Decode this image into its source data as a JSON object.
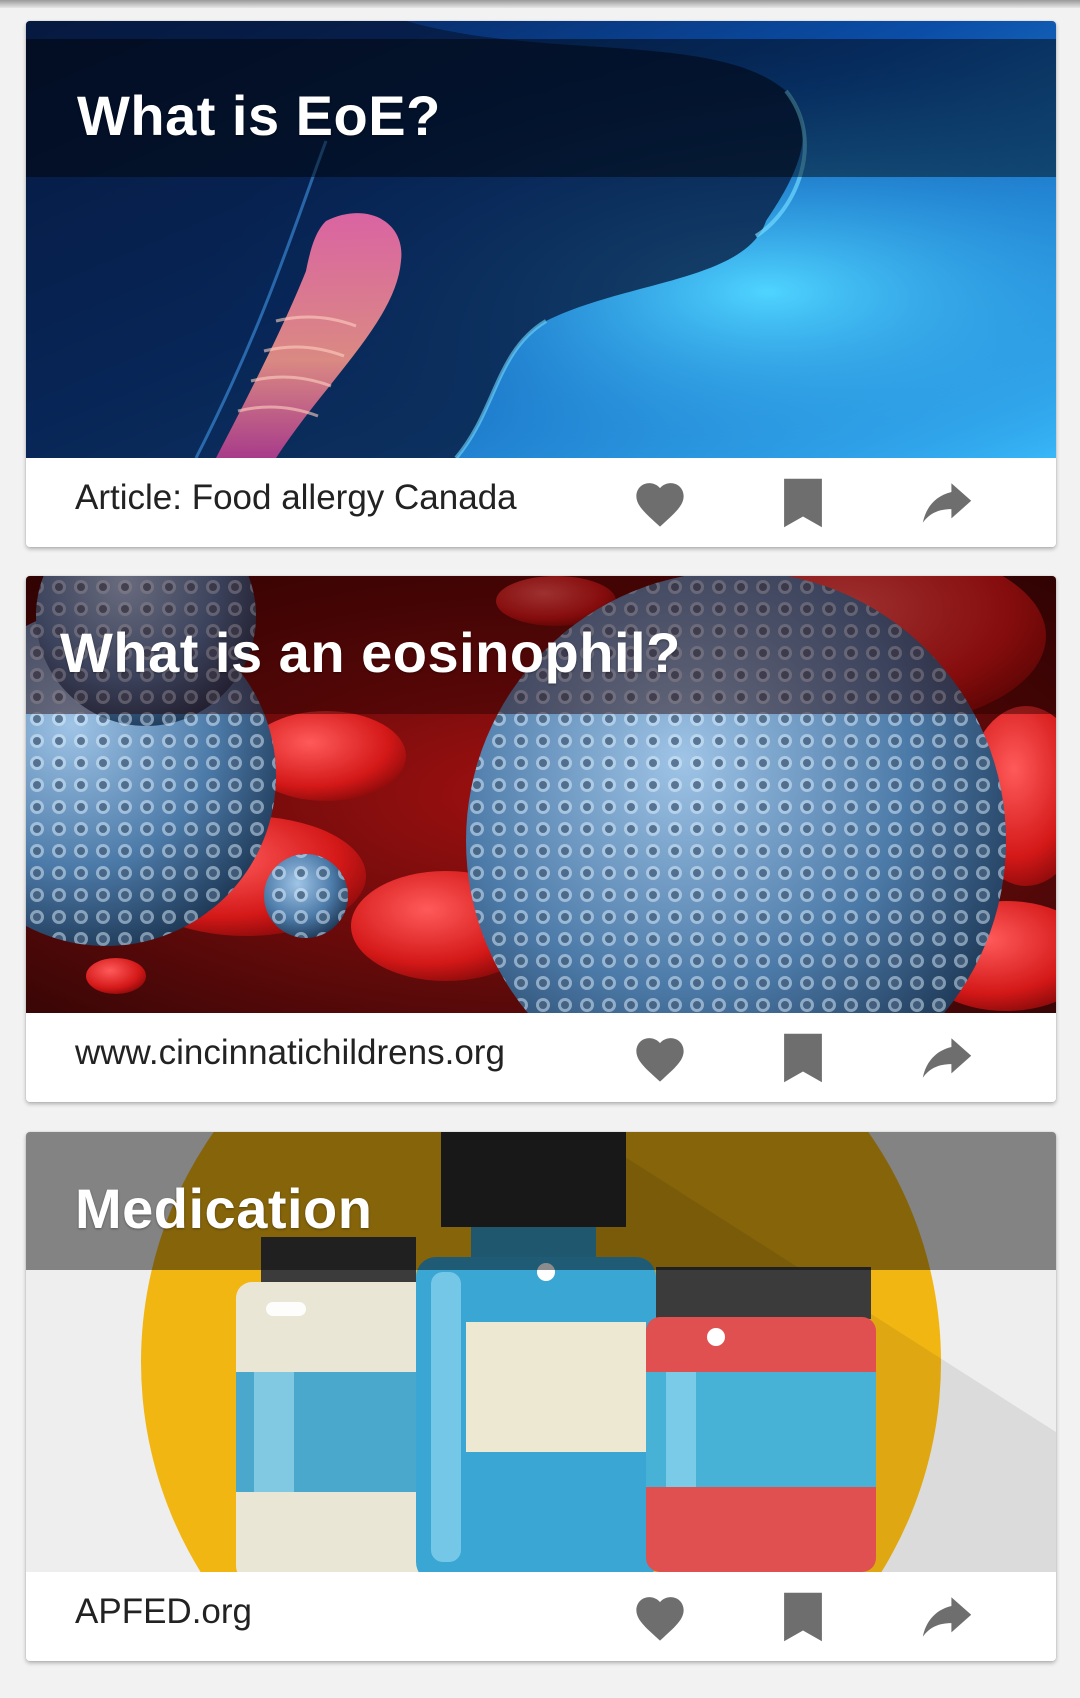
{
  "cards": [
    {
      "title": "What is EoE?",
      "source": "Article: Food allergy Canada",
      "image_icon": "throat-anatomy-illustration"
    },
    {
      "title": "What is an eosinophil?",
      "source": "www.cincinnatichildrens.org",
      "image_icon": "eosinophil-cells-illustration"
    },
    {
      "title": "Medication",
      "source": "APFED.org",
      "image_icon": "medicine-bottles-illustration"
    }
  ],
  "actions": {
    "like_icon": "heart-icon",
    "save_icon": "bookmark-icon",
    "share_icon": "share-icon"
  },
  "colors": {
    "icon_gray": "#6e6e6e",
    "title_text": "#ffffff",
    "source_text": "#222222"
  }
}
